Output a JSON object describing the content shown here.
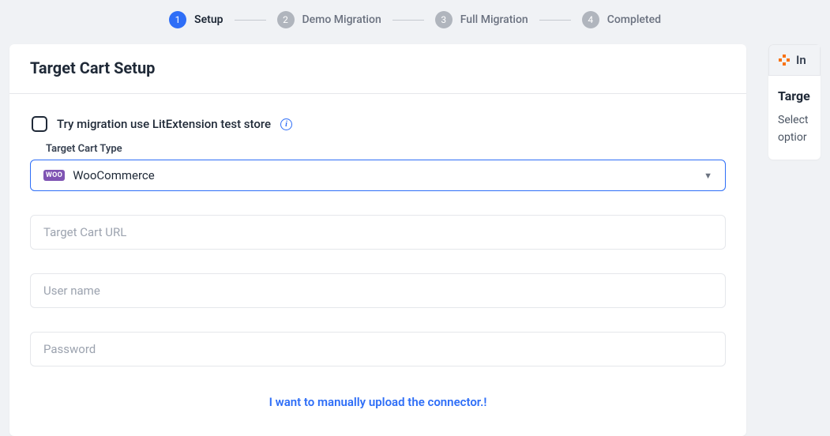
{
  "stepper": {
    "steps": [
      {
        "num": "1",
        "label": "Setup",
        "active": true
      },
      {
        "num": "2",
        "label": "Demo Migration",
        "active": false
      },
      {
        "num": "3",
        "label": "Full Migration",
        "active": false
      },
      {
        "num": "4",
        "label": "Completed",
        "active": false
      }
    ]
  },
  "card": {
    "title": "Target Cart Setup",
    "testStoreLabel": "Try migration use LitExtension test store",
    "cartTypeLabel": "Target Cart Type",
    "cartTypeValue": "WooCommerce",
    "cartTypeBadge": "WOO",
    "urlPlaceholder": "Target Cart URL",
    "urlValue": "",
    "userPlaceholder": "User name",
    "userValue": "",
    "passwordPlaceholder": "Password",
    "passwordValue": "",
    "manualLink": "I want to manually upload the connector.!"
  },
  "side": {
    "tabLabel": "In",
    "title": "Targe",
    "line1": "Select",
    "line2": "optior"
  }
}
